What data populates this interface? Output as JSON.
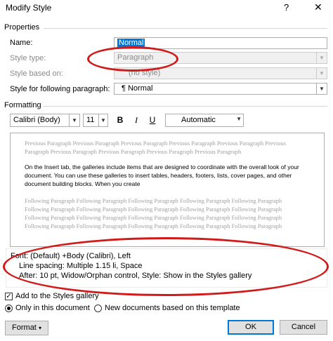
{
  "window": {
    "title": "Modify Style",
    "help_icon": "?",
    "close_icon": "✕"
  },
  "properties": {
    "section_label": "Properties",
    "name_label": "Name:",
    "name_value": "Normal",
    "style_type_label": "Style type:",
    "style_type_value": "Paragraph",
    "style_based_on_label": "Style based on:",
    "style_based_on_value": "(no style)",
    "following_label": "Style for following paragraph:",
    "following_value": "¶  Normal"
  },
  "formatting": {
    "section_label": "Formatting",
    "font": "Calibri (Body)",
    "size": "11",
    "bold": "B",
    "italic": "I",
    "underline": "U",
    "color": "Automatic"
  },
  "preview": {
    "previous_text": "Previous Paragraph Previous Paragraph Previous Paragraph Previous Paragraph Previous Paragraph Previous Paragraph Previous Paragraph Previous Paragraph Previous Paragraph Previous Paragraph",
    "previous_line1": "Previous Paragraph Previous Paragraph Previous Paragraph Previous Paragraph Previous Paragraph Previous",
    "previous_line2": "Paragraph Previous Paragraph Previous Paragraph Previous Paragraph Previous Paragraph",
    "body_line1": "On the Insert tab, the galleries include items that are designed to coordinate with the overall look of your",
    "body_line2": "document. You can use these galleries to insert tables, headers, footers, lists, cover pages, and other",
    "body_line3": "document building blocks. When you create",
    "following_line1": "Following Paragraph Following Paragraph Following Paragraph Following Paragraph Following Paragraph",
    "following_line2": "Following Paragraph Following Paragraph Following Paragraph Following Paragraph Following Paragraph",
    "following_line3": "Following Paragraph Following Paragraph Following Paragraph Following Paragraph Following Paragraph",
    "following_line4": "Following Paragraph Following Paragraph Following Paragraph Following Paragraph Following Paragraph"
  },
  "description": {
    "line1": "Font: (Default) +Body (Calibri), Left",
    "line2": "Line spacing:  Multiple 1.15 li, Space",
    "line3": "After:  10 pt, Widow/Orphan control, Style: Show in the Styles gallery"
  },
  "options": {
    "add_to_gallery": "Add to the Styles gallery",
    "add_to_gallery_checked": true,
    "only_this_doc": "Only in this document",
    "new_docs": "New documents based on this template"
  },
  "buttons": {
    "format": "Format",
    "ok": "OK",
    "cancel": "Cancel"
  },
  "colors": {
    "annotation": "#d11a1a",
    "accent": "#0078d7"
  }
}
